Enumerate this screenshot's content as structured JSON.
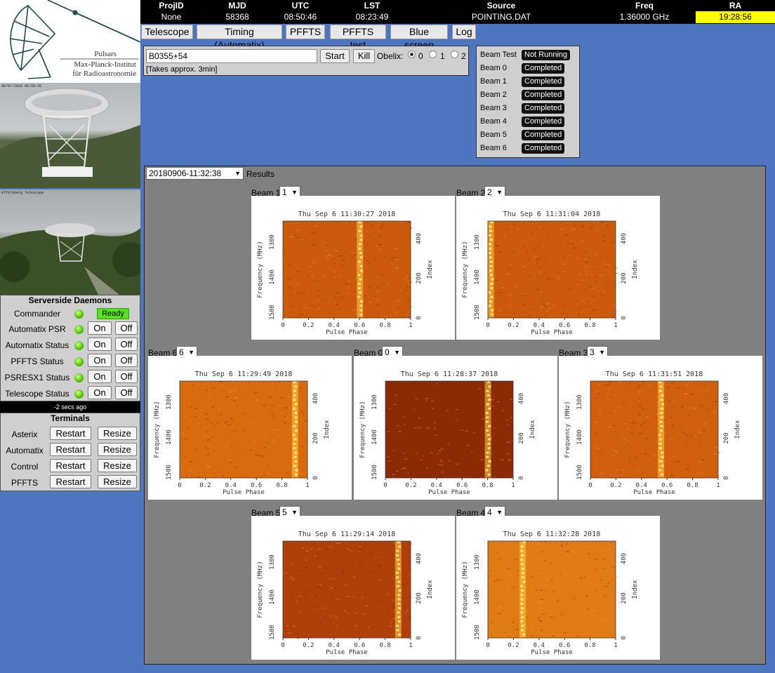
{
  "logo": {
    "line1": "Pulsars",
    "line2": "Max-Planck-Institut",
    "line3": "für Radioastronomie"
  },
  "webcams": {
    "stamp1": "06/07/2018 08:50:35",
    "stamp2": "Effelsberg Telescope"
  },
  "status_bar": {
    "headers": [
      "ProjID",
      "MJD",
      "UTC",
      "LST",
      "Source",
      "Freq",
      "RA"
    ],
    "values": [
      "None",
      "58368",
      "08:50:46",
      "08:23:49",
      "POINTING.DAT",
      "1.36000 GHz",
      "19:28:56"
    ],
    "ra_highlight": "#ffff00"
  },
  "tabs": [
    "Telescope",
    "Timing (Automatix)",
    "PFFTS",
    "PFFTS test",
    "Blue screen",
    "Log"
  ],
  "pointing": {
    "source_value": "B0355+54",
    "start_label": "Start",
    "kill_label": "Kill",
    "obelix_label": "Obelix:",
    "options": [
      "0",
      "1",
      "2"
    ],
    "selected": "0",
    "note": "[Takes approx. 3min]"
  },
  "beam_status": [
    {
      "label": "Beam Test",
      "status": "Not Running"
    },
    {
      "label": "Beam 0",
      "status": "Completed"
    },
    {
      "label": "Beam 1",
      "status": "Completed"
    },
    {
      "label": "Beam 2",
      "status": "Completed"
    },
    {
      "label": "Beam 3",
      "status": "Completed"
    },
    {
      "label": "Beam 4",
      "status": "Completed"
    },
    {
      "label": "Beam 5",
      "status": "Completed"
    },
    {
      "label": "Beam 6",
      "status": "Completed"
    }
  ],
  "daemons": {
    "title": "Serverside Daemons",
    "commander_label": "Commander",
    "ready_label": "Ready",
    "rows": [
      {
        "label": "Automatix PSR",
        "on": "On",
        "off": "Off"
      },
      {
        "label": "Automatix Status",
        "on": "On",
        "off": "Off"
      },
      {
        "label": "PFFTS Status",
        "on": "On",
        "off": "Off"
      },
      {
        "label": "PSRESX1 Status",
        "on": "On",
        "off": "Off"
      },
      {
        "label": "Telescope Status",
        "on": "On",
        "off": "Off"
      }
    ],
    "last_update": "-2 secs ago"
  },
  "terminals": {
    "title": "Terminals",
    "rows": [
      {
        "label": "Asterix",
        "restart": "Restart",
        "resize": "Resize"
      },
      {
        "label": "Automatix",
        "restart": "Restart",
        "resize": "Resize"
      },
      {
        "label": "Control",
        "restart": "Restart",
        "resize": "Resize"
      },
      {
        "label": "PFFTS",
        "restart": "Restart",
        "resize": "Resize"
      }
    ]
  },
  "results": {
    "run_selected": "20180906-11:32:38",
    "results_label": "Results",
    "plots": [
      {
        "beam_label": "Beam 1",
        "select_value": "1",
        "timestamp": "Thu Sep  6 11:30:27 2018",
        "pulse_phase": 0.6,
        "color": "#cc5a0c"
      },
      {
        "beam_label": "Beam 2",
        "select_value": "2",
        "timestamp": "Thu Sep  6 11:31:04 2018",
        "pulse_phase": 0.02,
        "color": "#cc5a0c"
      },
      {
        "beam_label": "Beam 6",
        "select_value": "6",
        "timestamp": "Thu Sep  6 11:29:49 2018",
        "pulse_phase": 0.9,
        "color": "#d86a10"
      },
      {
        "beam_label": "Beam 0",
        "select_value": "0",
        "timestamp": "Thu Sep  6 11:28:37 2018",
        "pulse_phase": 0.8,
        "color": "#8c2a06"
      },
      {
        "beam_label": "Beam 3",
        "select_value": "3",
        "timestamp": "Thu Sep  6 11:31:51 2018",
        "pulse_phase": 0.55,
        "color": "#d0600e"
      },
      {
        "beam_label": "Beam 5",
        "select_value": "5",
        "timestamp": "Thu Sep  6 11:29:14 2018",
        "pulse_phase": 0.9,
        "color": "#b0400a"
      },
      {
        "beam_label": "Beam 4",
        "select_value": "4",
        "timestamp": "Thu Sep  6 11:32:28 2018",
        "pulse_phase": 0.27,
        "color": "#e07a14"
      }
    ],
    "axes": {
      "xlabel": "Pulse Phase",
      "ylabel": "Frequency (MHz)",
      "y2label": "Index",
      "xticks": [
        "0",
        "0.2",
        "0.4",
        "0.6",
        "0.8",
        "1"
      ],
      "yticks": [
        "1300",
        "1400",
        "1500"
      ],
      "y2ticks": [
        "400",
        "200",
        "0"
      ]
    }
  }
}
